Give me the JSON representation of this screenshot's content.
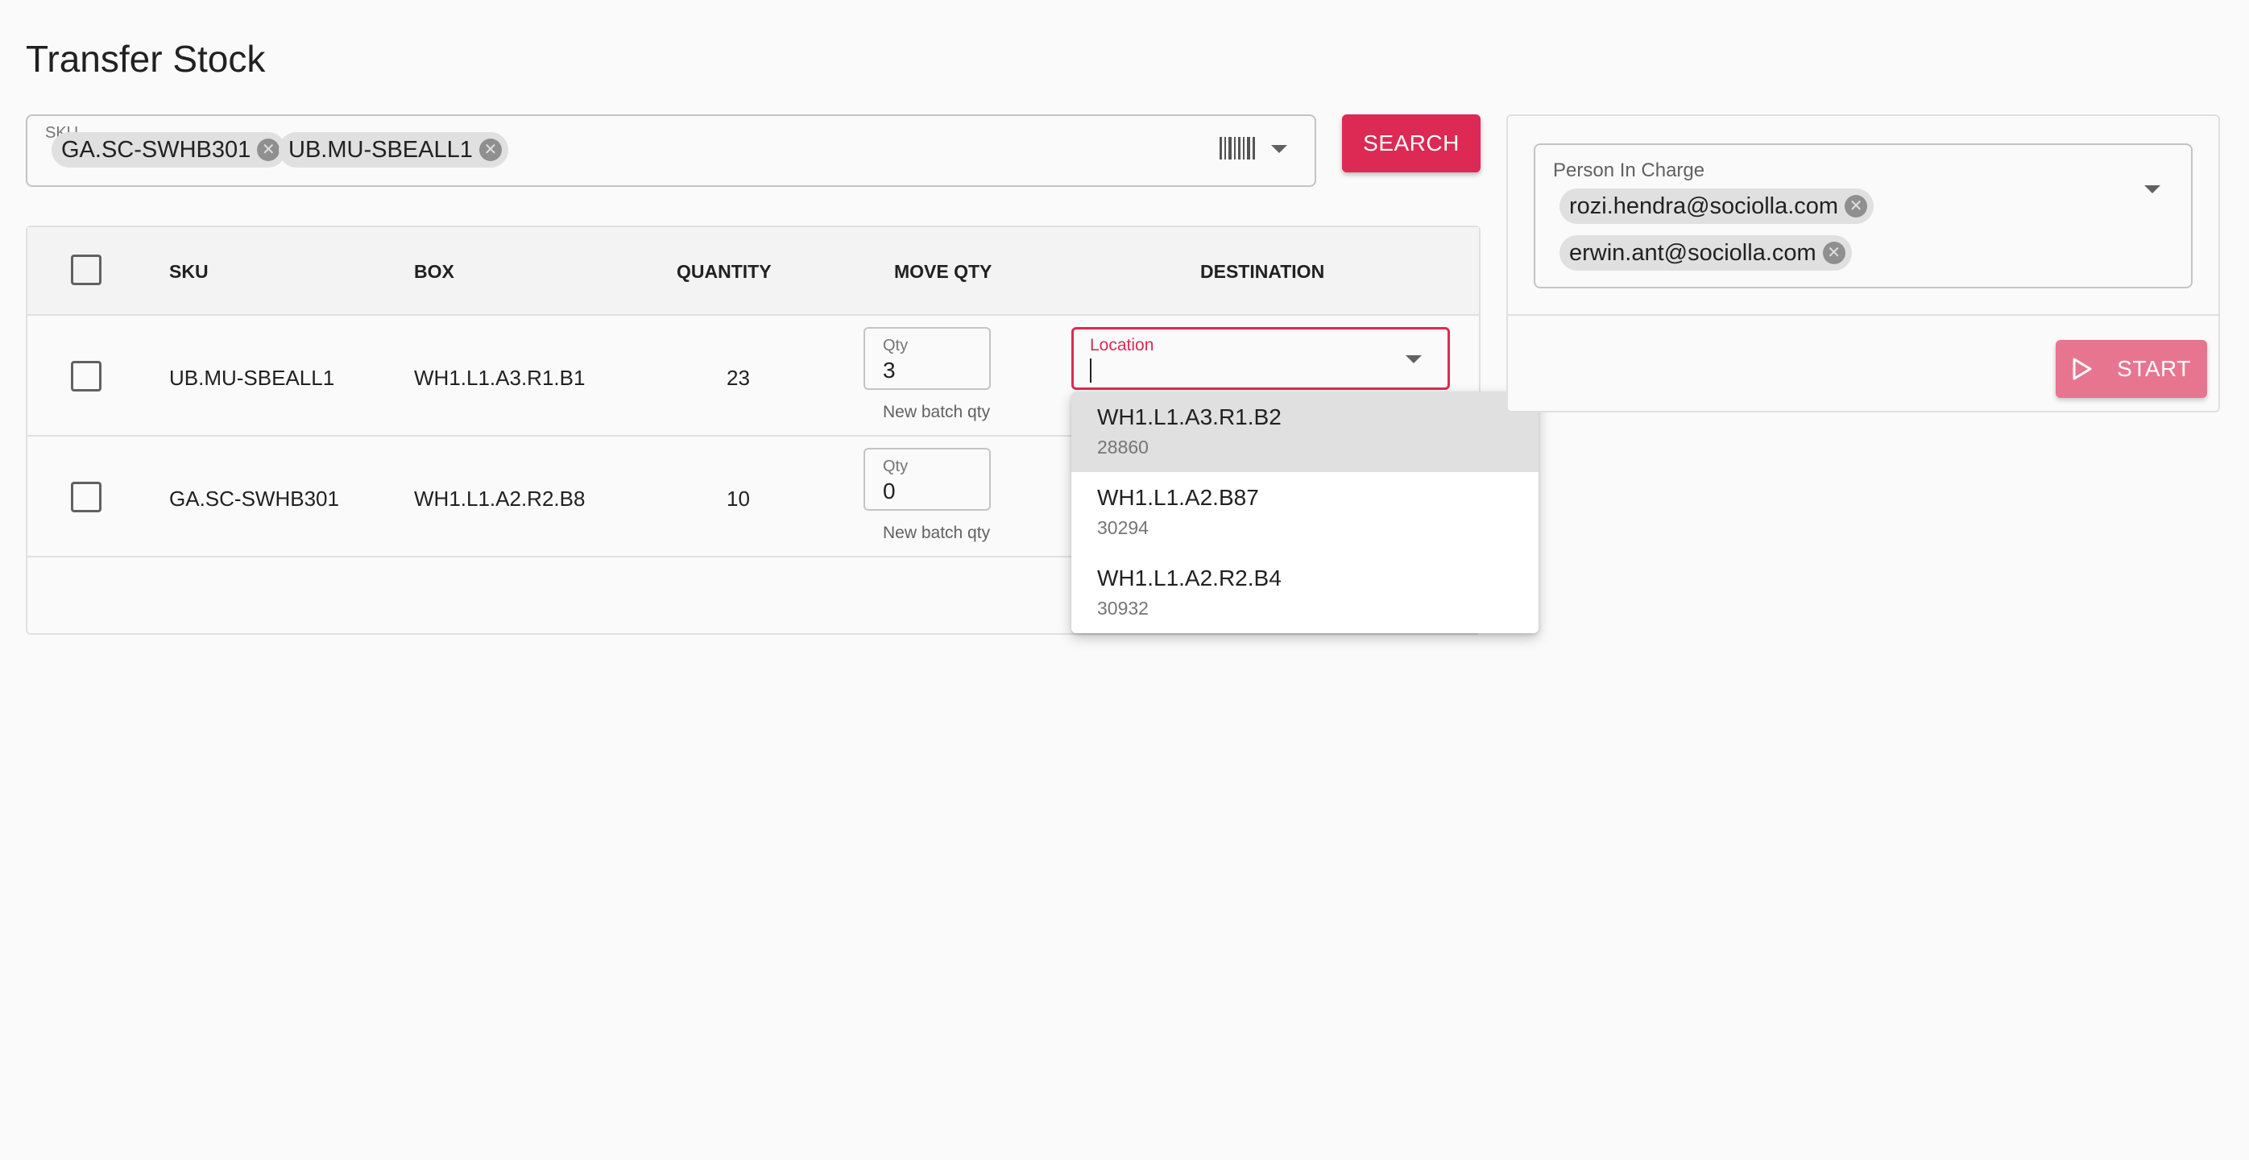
{
  "page": {
    "title": "Transfer Stock"
  },
  "sku_filter": {
    "label": "SKU.....",
    "chips": [
      "GA.SC-SWHB301",
      "UB.MU-SBEALL1"
    ],
    "barcode_icon": "barcode-icon",
    "dropdown_icon": "chevron-down-icon"
  },
  "search_button": {
    "label": "SEARCH"
  },
  "table": {
    "headers": {
      "sku": "SKU",
      "box": "BOX",
      "quantity": "QUANTITY",
      "move_qty": "MOVE QTY",
      "destination": "DESTINATION"
    },
    "rows": [
      {
        "sku": "UB.MU-SBEALL1",
        "box": "WH1.L1.A3.R1.B1",
        "quantity": "23",
        "qty_label": "Qty",
        "qty_value": "3",
        "helper": "New batch qty",
        "destination_label": "Location",
        "destination_value": ""
      },
      {
        "sku": "GA.SC-SWHB301",
        "box": "WH1.L1.A2.R2.B8",
        "quantity": "10",
        "qty_label": "Qty",
        "qty_value": "0",
        "helper": "New batch qty"
      }
    ]
  },
  "location_dropdown": {
    "options": [
      {
        "name": "WH1.L1.A3.R1.B2",
        "code": "28860",
        "active": true
      },
      {
        "name": "WH1.L1.A2.B87",
        "code": "30294"
      },
      {
        "name": "WH1.L1.A2.R2.B4",
        "code": "30932"
      }
    ]
  },
  "person_in_charge": {
    "label": "Person In Charge",
    "chips": [
      "rozi.hendra@sociolla.com",
      "erwin.ant@sociolla.com"
    ]
  },
  "start_button": {
    "label": "START",
    "icon": "play-outline-icon"
  },
  "colors": {
    "accent": "#dc2a54",
    "accent_disabled": "#e77590",
    "chip_bg": "#e0e0e0",
    "border": "#c4c4c4"
  }
}
